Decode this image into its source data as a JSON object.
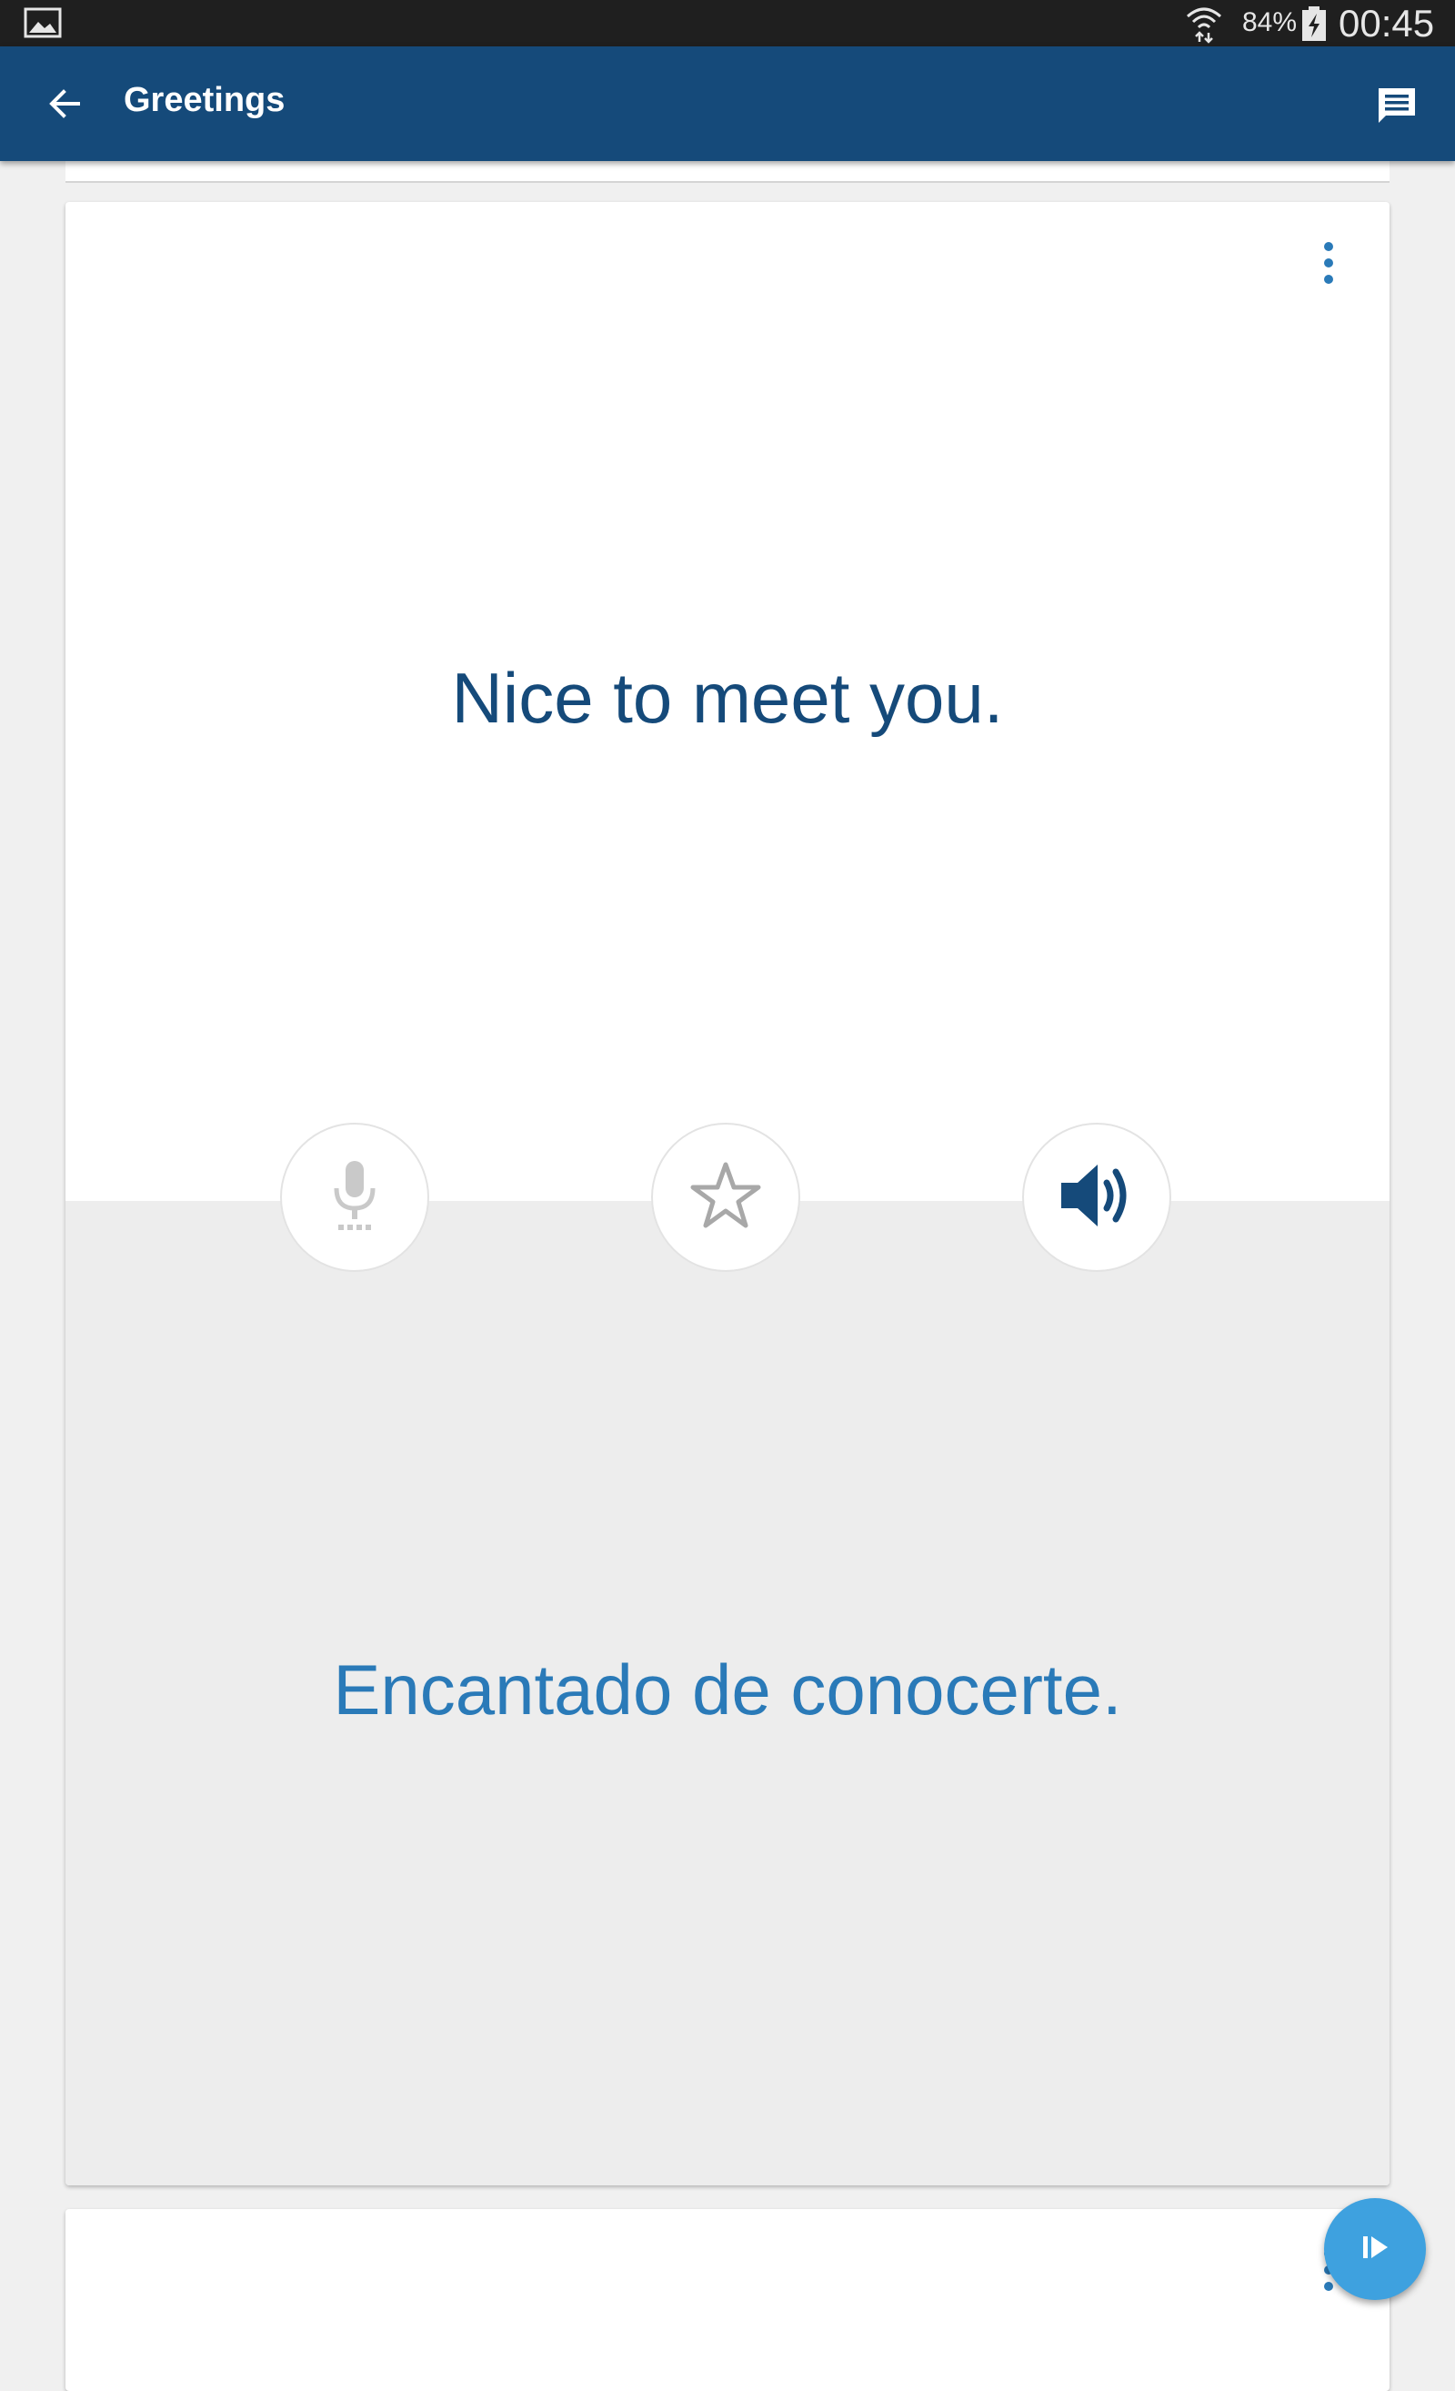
{
  "status_bar": {
    "battery_percent": "84%",
    "time": "00:45",
    "icons": [
      "image-notification-icon",
      "wifi-icon",
      "battery-charging-icon"
    ]
  },
  "app_bar": {
    "title": "Greetings",
    "back_icon": "arrow-left-icon",
    "action_icon": "chat-icon"
  },
  "card": {
    "phrase": "Nice to meet you.",
    "translation": "Encantado de conocerte.",
    "actions": [
      "microphone",
      "favorite-star",
      "play-audio"
    ],
    "menu_icon": "more-vert-icon"
  },
  "fab": {
    "icon": "play-next-icon"
  },
  "colors": {
    "app_bar": "#154a7a",
    "primary_text": "#154a7a",
    "translation_text": "#2a7ab8",
    "fab": "#3ea1df"
  }
}
